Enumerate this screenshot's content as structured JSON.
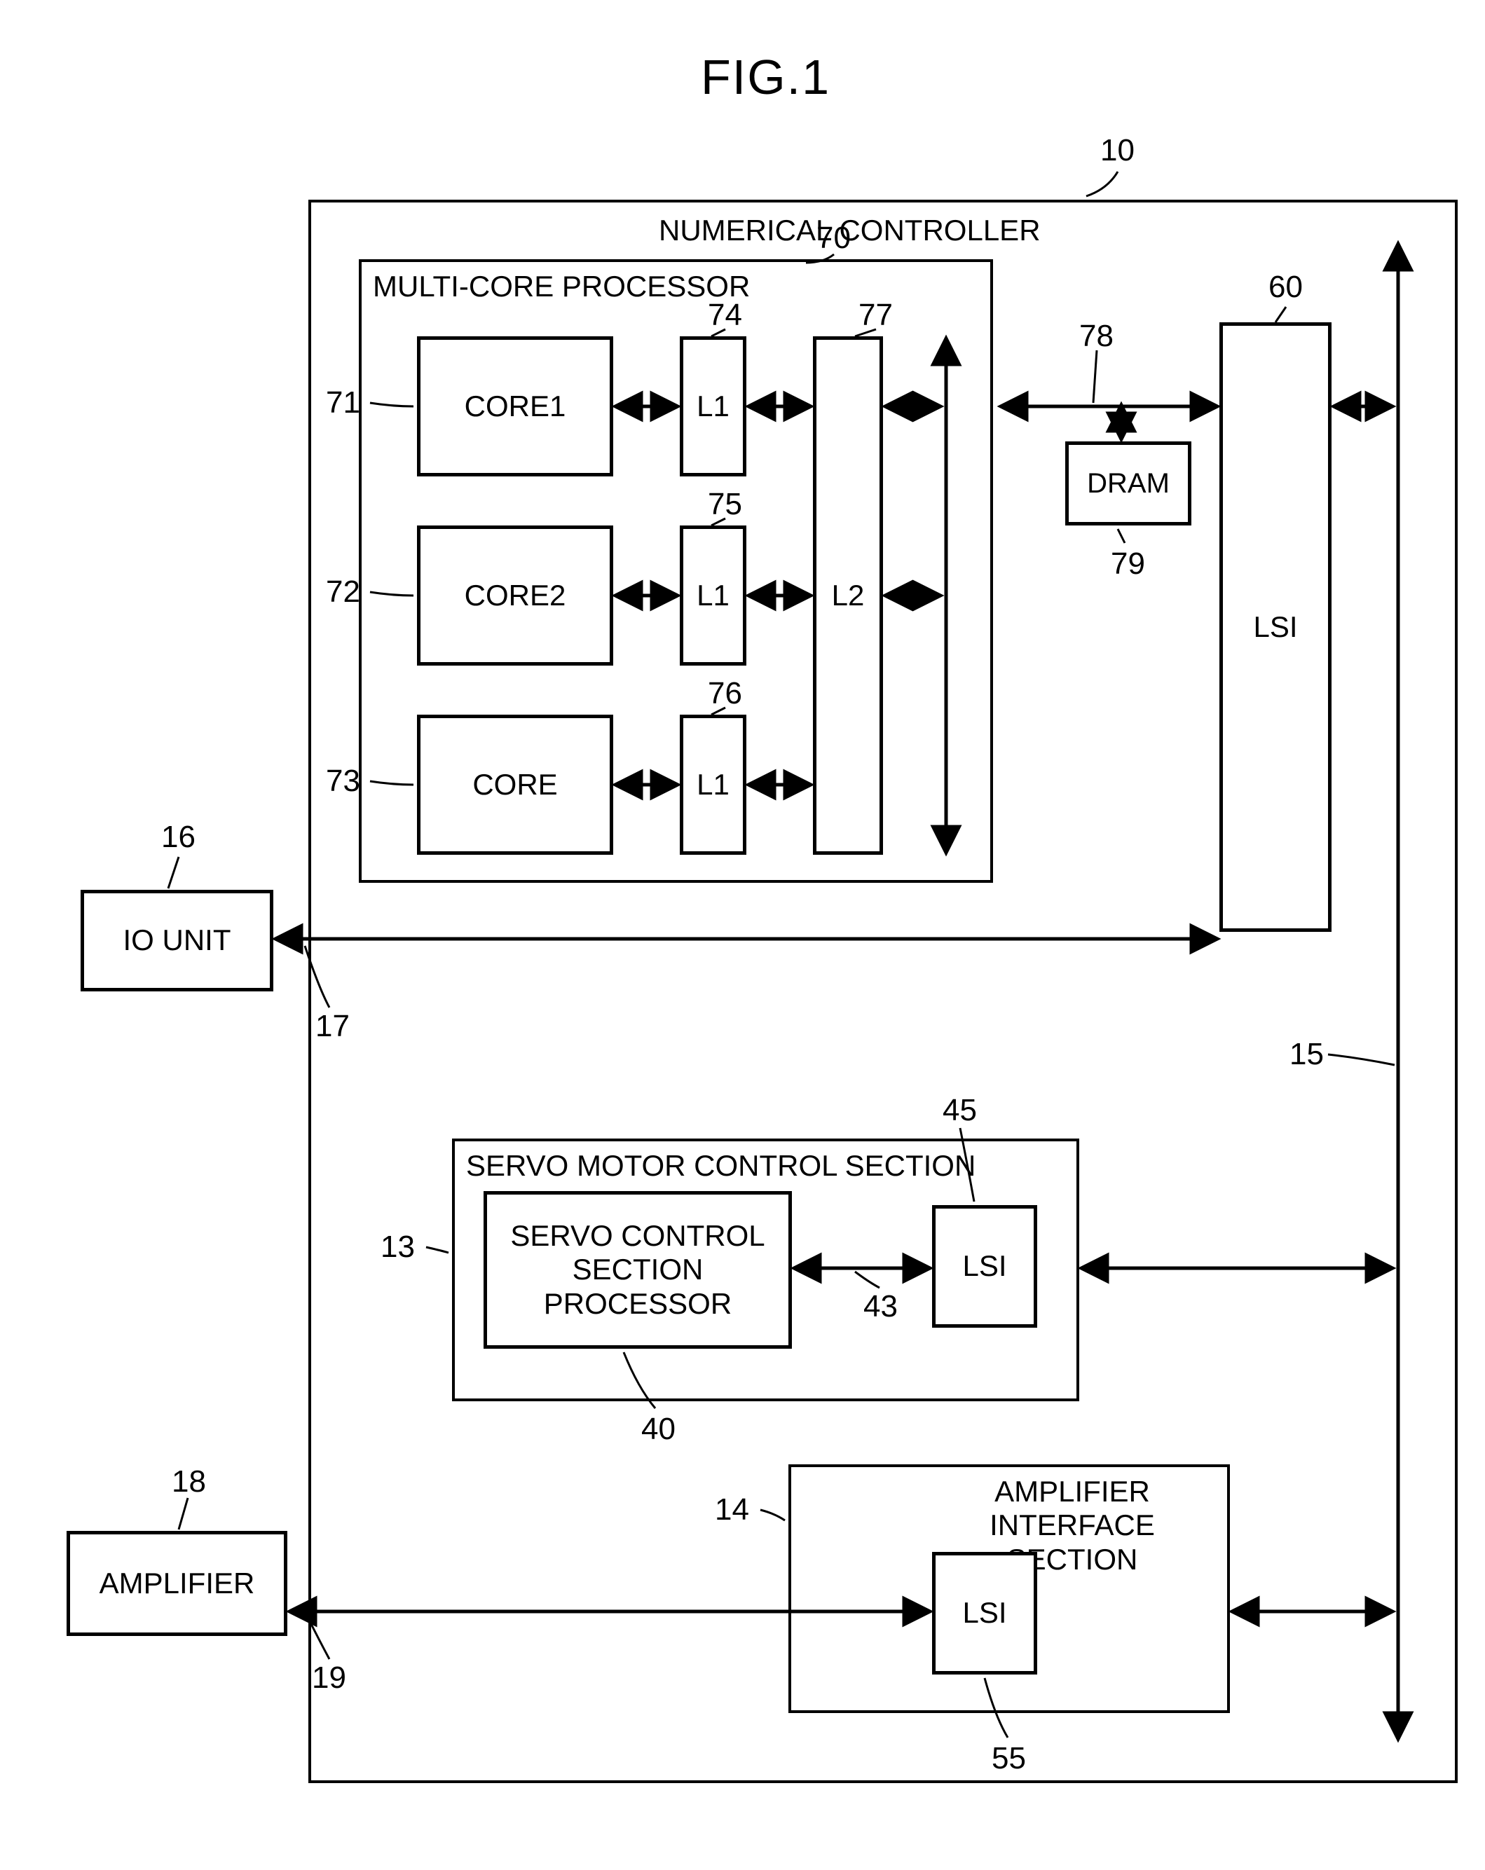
{
  "figure_title": "FIG.1",
  "controller": {
    "title": "NUMERICAL CONTROLLER",
    "ref": "10"
  },
  "multicore": {
    "title": "MULTI-CORE PROCESSOR",
    "ref": "70",
    "core1": "CORE1",
    "core2": "CORE2",
    "core3": "CORE",
    "l1a": "L1",
    "l1b": "L1",
    "l1c": "L1",
    "l2": "L2",
    "ref71": "71",
    "ref72": "72",
    "ref73": "73",
    "ref74": "74",
    "ref75": "75",
    "ref76": "76",
    "ref77": "77"
  },
  "bus": {
    "ref78": "78",
    "ref15": "15"
  },
  "dram": {
    "label": "DRAM",
    "ref": "79"
  },
  "lsi_main": {
    "label": "LSI",
    "ref": "60"
  },
  "io_unit": {
    "label": "IO UNIT",
    "ref16": "16",
    "ref17": "17"
  },
  "servo": {
    "title": "SERVO MOTOR CONTROL SECTION",
    "processor_label_l1": "SERVO CONTROL",
    "processor_label_l2": "SECTION",
    "processor_label_l3": "PROCESSOR",
    "lsi": "LSI",
    "ref13": "13",
    "ref40": "40",
    "ref43": "43",
    "ref45": "45"
  },
  "amplifier_if": {
    "title_l1": "AMPLIFIER",
    "title_l2": "INTERFACE SECTION",
    "lsi": "LSI",
    "ref14": "14",
    "ref55": "55"
  },
  "amplifier": {
    "label": "AMPLIFIER",
    "ref18": "18",
    "ref19": "19"
  }
}
